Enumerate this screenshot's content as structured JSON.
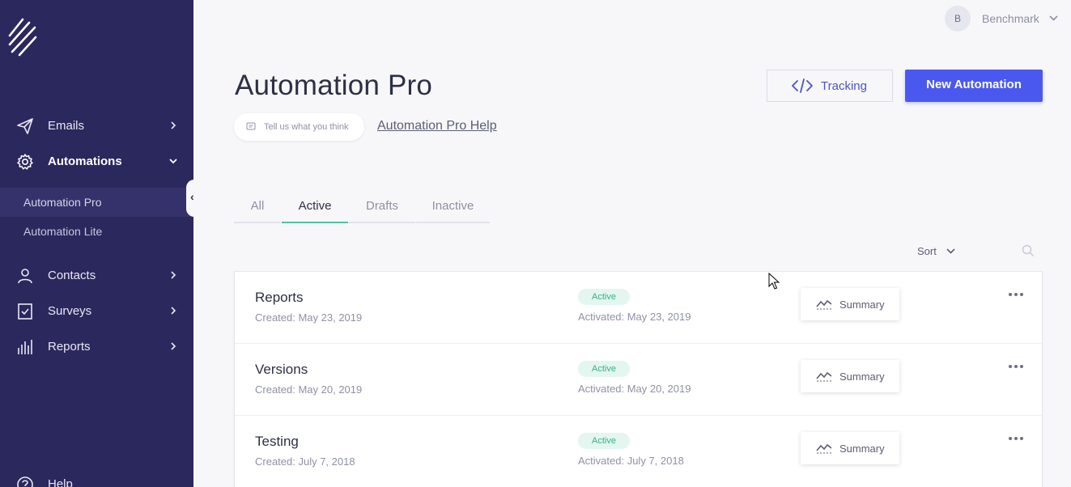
{
  "sidebar": {
    "logo": "brand-stripes-logo",
    "items": [
      {
        "label": "Emails",
        "icon": "paper-plane-icon"
      },
      {
        "label": "Automations",
        "icon": "gear-icon"
      },
      {
        "label": "Contacts",
        "icon": "user-icon"
      },
      {
        "label": "Surveys",
        "icon": "checklist-icon"
      },
      {
        "label": "Reports",
        "icon": "bar-chart-icon"
      },
      {
        "label": "Help",
        "icon": "question-icon"
      }
    ],
    "sub_items": [
      {
        "label": "Automation Pro",
        "active": true
      },
      {
        "label": "Automation Lite",
        "active": false
      }
    ],
    "colors": {
      "background": "#2b285e",
      "active_sub": "#35326b"
    }
  },
  "user": {
    "initial": "B",
    "name": "Benchmark"
  },
  "header": {
    "title": "Automation Pro",
    "feedback_label": "Tell us what you think",
    "help_link": "Automation Pro Help",
    "tracking_label": "Tracking",
    "new_button_label": "New Automation"
  },
  "tabs": [
    {
      "label": "All",
      "active": false
    },
    {
      "label": "Active",
      "active": true
    },
    {
      "label": "Drafts",
      "active": false
    },
    {
      "label": "Inactive",
      "active": false
    }
  ],
  "toolbar": {
    "sort_label": "Sort"
  },
  "rows": [
    {
      "name": "Reports",
      "created": "Created: May 23, 2019",
      "status": "Active",
      "activated": "Activated: May 23, 2019",
      "summary_label": "Summary"
    },
    {
      "name": "Versions",
      "created": "Created: May 20, 2019",
      "status": "Active",
      "activated": "Activated: May 20, 2019",
      "summary_label": "Summary"
    },
    {
      "name": "Testing",
      "created": "Created: July 7, 2018",
      "status": "Active",
      "activated": "Activated: July 7, 2018",
      "summary_label": "Summary"
    }
  ],
  "colors": {
    "accent": "#4b58f0",
    "active_tab": "#4fc3a1",
    "status_green": "#38b08a"
  }
}
